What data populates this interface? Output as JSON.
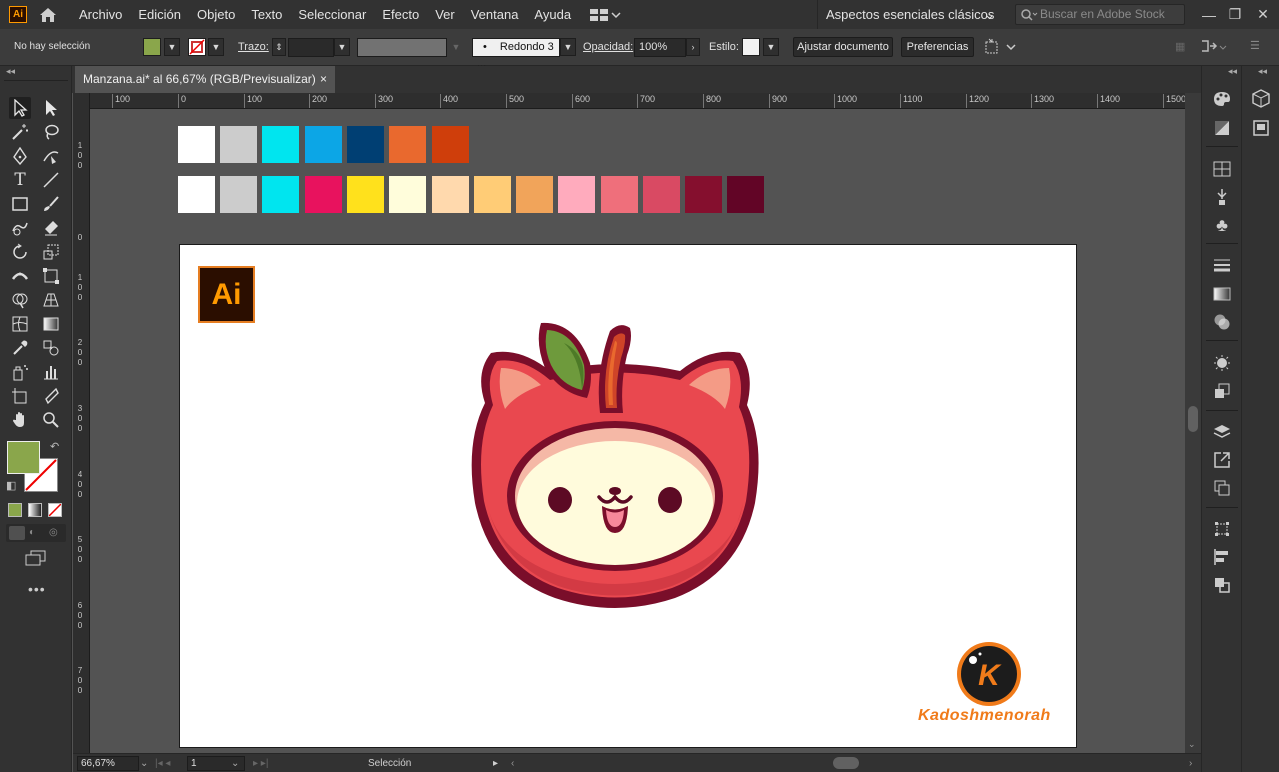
{
  "app": {
    "badge": "Ai",
    "menu": [
      "Archivo",
      "Edición",
      "Objeto",
      "Texto",
      "Seleccionar",
      "Efecto",
      "Ver",
      "Ventana",
      "Ayuda"
    ],
    "workspace": "Aspectos esenciales clásicos",
    "search_placeholder": "Buscar en Adobe Stock"
  },
  "control_bar": {
    "selection_status": "No hay selección",
    "stroke_label": "Trazo:",
    "brush_label": "Redondo 3 ...",
    "opacity_label": "Opacidad:",
    "opacity_value": "100%",
    "style_label": "Estilo:",
    "fit_document_button": "Ajustar documento",
    "preferences_button": "Preferencias",
    "fill_color": "#8aa64b",
    "stroke_color": "none"
  },
  "document": {
    "tab_title": "Manzana.ai* al 66,67% (RGB/Previsualizar)",
    "close_glyph": "×"
  },
  "rulers": {
    "horizontal": [
      "100",
      "0",
      "100",
      "200",
      "300",
      "400",
      "500",
      "600",
      "700",
      "800",
      "900",
      "1000",
      "1100",
      "1200",
      "1300",
      "1400",
      "1500"
    ],
    "vertical": [
      "1 0 0",
      "0",
      "1 0 0",
      "2 0 0",
      "3 0 0",
      "4 0 0",
      "5 0 0",
      "6 0 0",
      "7 0 0"
    ]
  },
  "swatches": {
    "row1": [
      "#ffffff",
      "#cccccc",
      "#00e5ef",
      "#0ca6e6",
      "#003f73",
      "#e9692e",
      "#cf3e0b"
    ],
    "row2": [
      "#ffffff",
      "#cccccc",
      "#00e5ef",
      "#e8125e",
      "#ffe11c",
      "#fffddb",
      "#ffd9ad",
      "#ffcc76",
      "#f1a45a",
      "#ffabbd",
      "#ef6f7b",
      "#d94a63",
      "#850f2e",
      "#620526"
    ]
  },
  "artboard": {
    "logo_text": "Ai",
    "brand_name": "Kadoshmenorah",
    "brand_initial": "K"
  },
  "status_bar": {
    "zoom": "66,67%",
    "artboard_number": "1",
    "current_tool": "Selección"
  }
}
